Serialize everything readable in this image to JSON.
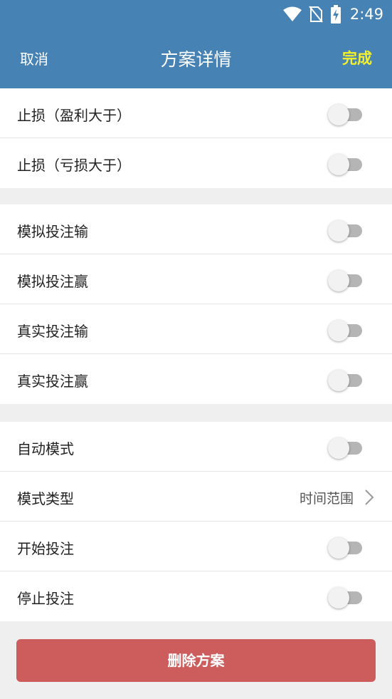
{
  "status_bar": {
    "time": "2:49"
  },
  "header": {
    "cancel": "取消",
    "title": "方案详情",
    "done": "完成"
  },
  "groups": [
    {
      "rows": [
        {
          "label": "止损（盈利大于）",
          "toggle": false
        },
        {
          "label": "止损（亏损大于）",
          "toggle": false
        }
      ]
    },
    {
      "rows": [
        {
          "label": "模拟投注输",
          "toggle": false
        },
        {
          "label": "模拟投注赢",
          "toggle": false
        },
        {
          "label": "真实投注输",
          "toggle": false
        },
        {
          "label": "真实投注赢",
          "toggle": false
        }
      ]
    },
    {
      "rows": [
        {
          "label": "自动模式",
          "toggle": false
        },
        {
          "label": "模式类型",
          "value": "时间范围"
        },
        {
          "label": "开始投注",
          "toggle": false
        },
        {
          "label": "停止投注",
          "toggle": false
        }
      ]
    }
  ],
  "delete_button": "删除方案",
  "colors": {
    "header": "#4682b4",
    "done": "#f4f12c",
    "delete": "#cd5c5c"
  }
}
